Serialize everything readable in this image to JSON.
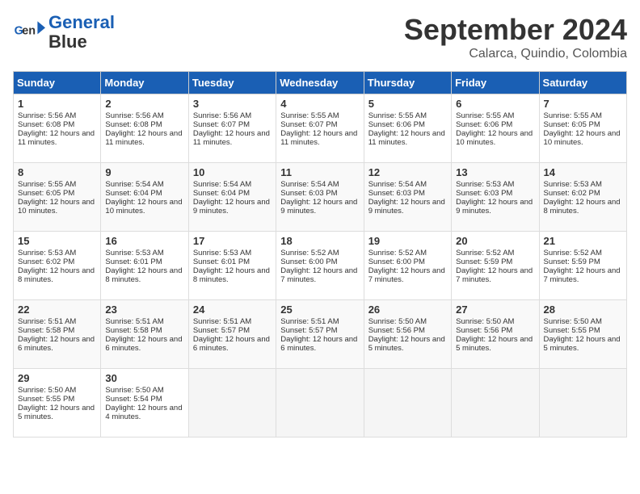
{
  "header": {
    "logo_line1": "General",
    "logo_line2": "Blue",
    "month_title": "September 2024",
    "location": "Calarca, Quindio, Colombia"
  },
  "days_of_week": [
    "Sunday",
    "Monday",
    "Tuesday",
    "Wednesday",
    "Thursday",
    "Friday",
    "Saturday"
  ],
  "weeks": [
    [
      {
        "num": "1",
        "sunrise": "5:56 AM",
        "sunset": "6:08 PM",
        "daylight": "12 hours and 11 minutes."
      },
      {
        "num": "2",
        "sunrise": "5:56 AM",
        "sunset": "6:08 PM",
        "daylight": "12 hours and 11 minutes."
      },
      {
        "num": "3",
        "sunrise": "5:56 AM",
        "sunset": "6:07 PM",
        "daylight": "12 hours and 11 minutes."
      },
      {
        "num": "4",
        "sunrise": "5:55 AM",
        "sunset": "6:07 PM",
        "daylight": "12 hours and 11 minutes."
      },
      {
        "num": "5",
        "sunrise": "5:55 AM",
        "sunset": "6:06 PM",
        "daylight": "12 hours and 11 minutes."
      },
      {
        "num": "6",
        "sunrise": "5:55 AM",
        "sunset": "6:06 PM",
        "daylight": "12 hours and 10 minutes."
      },
      {
        "num": "7",
        "sunrise": "5:55 AM",
        "sunset": "6:05 PM",
        "daylight": "12 hours and 10 minutes."
      }
    ],
    [
      {
        "num": "8",
        "sunrise": "5:55 AM",
        "sunset": "6:05 PM",
        "daylight": "12 hours and 10 minutes."
      },
      {
        "num": "9",
        "sunrise": "5:54 AM",
        "sunset": "6:04 PM",
        "daylight": "12 hours and 10 minutes."
      },
      {
        "num": "10",
        "sunrise": "5:54 AM",
        "sunset": "6:04 PM",
        "daylight": "12 hours and 9 minutes."
      },
      {
        "num": "11",
        "sunrise": "5:54 AM",
        "sunset": "6:03 PM",
        "daylight": "12 hours and 9 minutes."
      },
      {
        "num": "12",
        "sunrise": "5:54 AM",
        "sunset": "6:03 PM",
        "daylight": "12 hours and 9 minutes."
      },
      {
        "num": "13",
        "sunrise": "5:53 AM",
        "sunset": "6:03 PM",
        "daylight": "12 hours and 9 minutes."
      },
      {
        "num": "14",
        "sunrise": "5:53 AM",
        "sunset": "6:02 PM",
        "daylight": "12 hours and 8 minutes."
      }
    ],
    [
      {
        "num": "15",
        "sunrise": "5:53 AM",
        "sunset": "6:02 PM",
        "daylight": "12 hours and 8 minutes."
      },
      {
        "num": "16",
        "sunrise": "5:53 AM",
        "sunset": "6:01 PM",
        "daylight": "12 hours and 8 minutes."
      },
      {
        "num": "17",
        "sunrise": "5:53 AM",
        "sunset": "6:01 PM",
        "daylight": "12 hours and 8 minutes."
      },
      {
        "num": "18",
        "sunrise": "5:52 AM",
        "sunset": "6:00 PM",
        "daylight": "12 hours and 7 minutes."
      },
      {
        "num": "19",
        "sunrise": "5:52 AM",
        "sunset": "6:00 PM",
        "daylight": "12 hours and 7 minutes."
      },
      {
        "num": "20",
        "sunrise": "5:52 AM",
        "sunset": "5:59 PM",
        "daylight": "12 hours and 7 minutes."
      },
      {
        "num": "21",
        "sunrise": "5:52 AM",
        "sunset": "5:59 PM",
        "daylight": "12 hours and 7 minutes."
      }
    ],
    [
      {
        "num": "22",
        "sunrise": "5:51 AM",
        "sunset": "5:58 PM",
        "daylight": "12 hours and 6 minutes."
      },
      {
        "num": "23",
        "sunrise": "5:51 AM",
        "sunset": "5:58 PM",
        "daylight": "12 hours and 6 minutes."
      },
      {
        "num": "24",
        "sunrise": "5:51 AM",
        "sunset": "5:57 PM",
        "daylight": "12 hours and 6 minutes."
      },
      {
        "num": "25",
        "sunrise": "5:51 AM",
        "sunset": "5:57 PM",
        "daylight": "12 hours and 6 minutes."
      },
      {
        "num": "26",
        "sunrise": "5:50 AM",
        "sunset": "5:56 PM",
        "daylight": "12 hours and 5 minutes."
      },
      {
        "num": "27",
        "sunrise": "5:50 AM",
        "sunset": "5:56 PM",
        "daylight": "12 hours and 5 minutes."
      },
      {
        "num": "28",
        "sunrise": "5:50 AM",
        "sunset": "5:55 PM",
        "daylight": "12 hours and 5 minutes."
      }
    ],
    [
      {
        "num": "29",
        "sunrise": "5:50 AM",
        "sunset": "5:55 PM",
        "daylight": "12 hours and 5 minutes."
      },
      {
        "num": "30",
        "sunrise": "5:50 AM",
        "sunset": "5:54 PM",
        "daylight": "12 hours and 4 minutes."
      },
      null,
      null,
      null,
      null,
      null
    ]
  ]
}
